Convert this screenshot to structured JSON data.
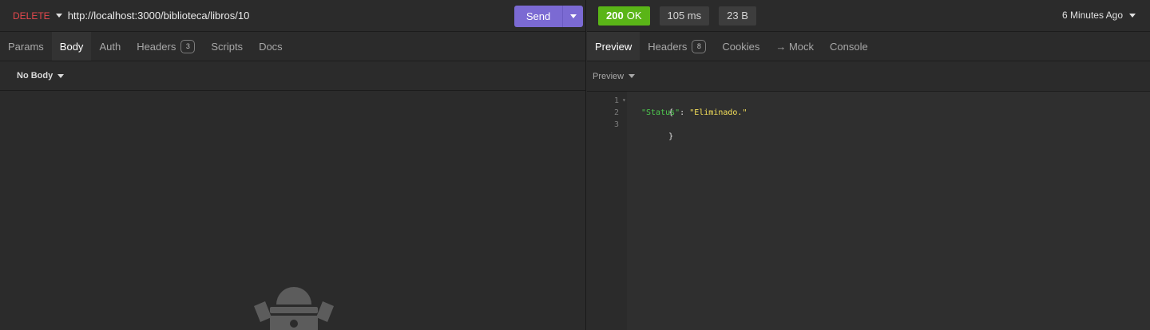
{
  "request": {
    "method": "DELETE",
    "url": "http://localhost:3000/biblioteca/libros/10",
    "send_label": "Send"
  },
  "request_tabs": [
    {
      "label": "Params"
    },
    {
      "label": "Body"
    },
    {
      "label": "Auth"
    },
    {
      "label": "Headers",
      "badge": "3"
    },
    {
      "label": "Scripts"
    },
    {
      "label": "Docs"
    }
  ],
  "body_type": "No Body",
  "response": {
    "status_code": "200",
    "status_text": "OK",
    "time": "105 ms",
    "size": "23 B",
    "time_ago": "6 Minutes Ago",
    "tabs": [
      {
        "label": "Preview"
      },
      {
        "label": "Headers",
        "badge": "8"
      },
      {
        "label": "Cookies"
      },
      {
        "label": "→ Mock"
      },
      {
        "label": "Console"
      }
    ],
    "preview_mode": "Preview",
    "code": {
      "line_numbers": [
        "1",
        "2",
        "3"
      ],
      "open_brace": "{",
      "key": "\"Status\"",
      "colon": ": ",
      "value": "\"Eliminado.\"",
      "close_brace": "}"
    }
  },
  "colors": {
    "method_delete": "#e5484d",
    "send": "#7b6ad3",
    "status_ok": "#5ab517",
    "json_key": "#4ec94e",
    "json_string": "#f5e05a"
  }
}
